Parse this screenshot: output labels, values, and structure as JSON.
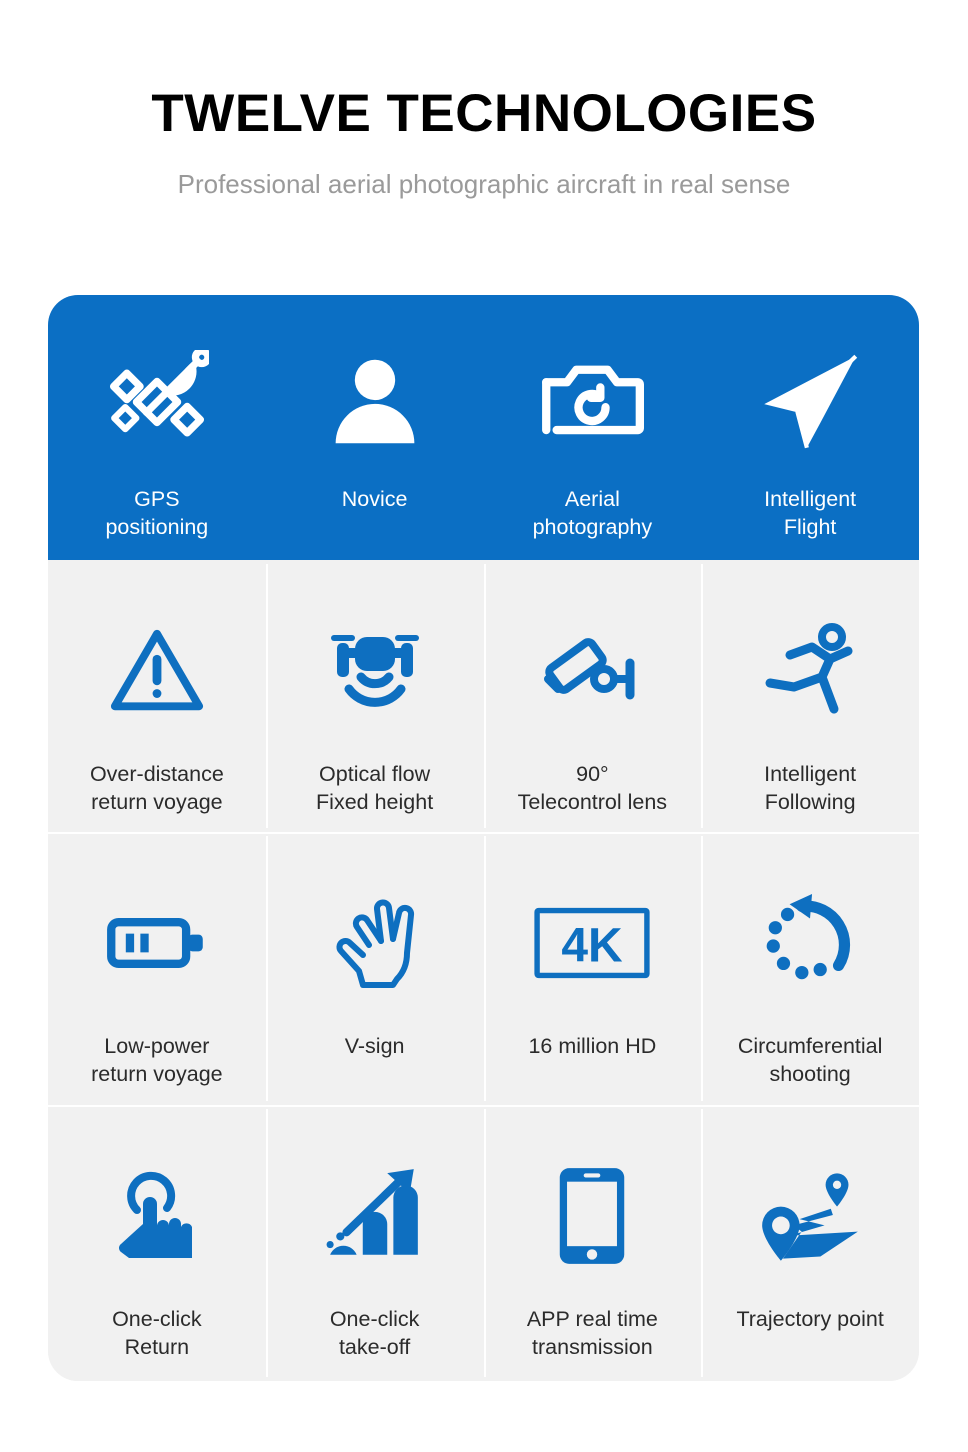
{
  "header": {
    "title": "TWELVE TECHNOLOGIES",
    "subtitle": "Professional aerial photographic aircraft in real sense"
  },
  "colors": {
    "accent_blue": "#0b6fc4",
    "icon_blue": "#0e6fc0",
    "cell_background": "#f1f1f1",
    "page_background": "#ffffff",
    "title_text": "#000000",
    "subtitle_text": "#9a9a9a",
    "label_text": "#2b2b2b",
    "highlight_label_text": "#ffffff"
  },
  "grid": {
    "columns": 4,
    "rows": 4,
    "highlighted_row_index": 0,
    "features": [
      {
        "icon": "satellite-icon",
        "label": "GPS\npositioning",
        "highlighted": true
      },
      {
        "icon": "person-icon",
        "label": "Novice",
        "highlighted": true
      },
      {
        "icon": "camera-icon",
        "label": "Aerial\nphotography",
        "highlighted": true
      },
      {
        "icon": "paper-plane-icon",
        "label": "Intelligent\nFlight",
        "highlighted": true
      },
      {
        "icon": "warning-triangle-icon",
        "label": "Over-distance\nreturn voyage",
        "highlighted": false
      },
      {
        "icon": "drone-sonar-icon",
        "label": "Optical flow\nFixed height",
        "highlighted": false
      },
      {
        "icon": "security-camera-icon",
        "label": "90°\nTelecontrol lens",
        "highlighted": false
      },
      {
        "icon": "running-person-icon",
        "label": "Intelligent\nFollowing",
        "highlighted": false
      },
      {
        "icon": "battery-low-icon",
        "label": "Low-power\nreturn voyage",
        "highlighted": false
      },
      {
        "icon": "v-sign-hand-icon",
        "label": "V-sign",
        "highlighted": false
      },
      {
        "icon": "four-k-icon",
        "label": "16 million HD",
        "highlighted": false
      },
      {
        "icon": "circular-dotted-arrow-icon",
        "label": "Circumferential\nshooting",
        "highlighted": false
      },
      {
        "icon": "tap-hand-icon",
        "label": "One-click\nReturn",
        "highlighted": false
      },
      {
        "icon": "bar-chart-arrow-icon",
        "label": "One-click\ntake-off",
        "highlighted": false
      },
      {
        "icon": "smartphone-icon",
        "label": "APP real time\ntransmission",
        "highlighted": false
      },
      {
        "icon": "route-pins-icon",
        "label": "Trajectory point",
        "highlighted": false
      }
    ]
  }
}
